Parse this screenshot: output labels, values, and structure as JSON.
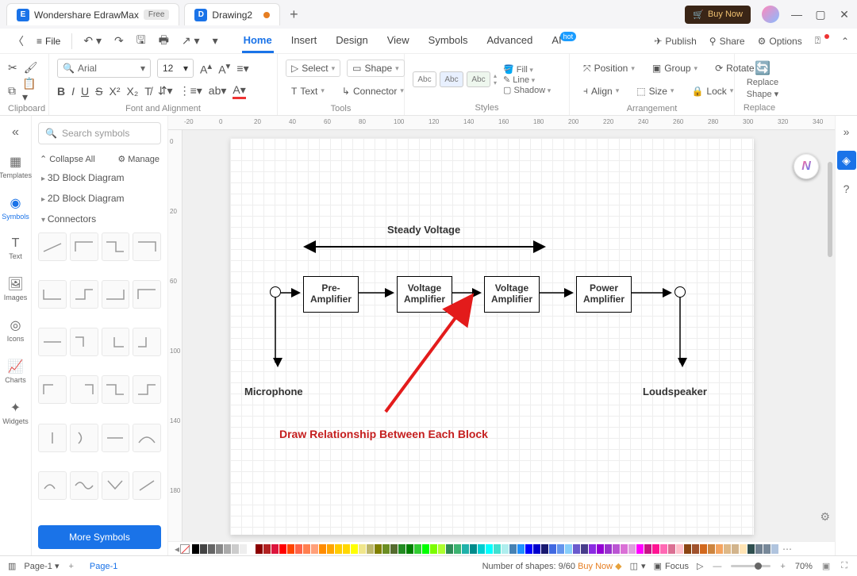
{
  "titlebar": {
    "app_name": "Wondershare EdrawMax",
    "free_badge": "Free",
    "doc_name": "Drawing2",
    "buy_now": "Buy Now"
  },
  "menubar": {
    "file": "File",
    "tabs": [
      "Home",
      "Insert",
      "Design",
      "View",
      "Symbols",
      "Advanced",
      "AI"
    ],
    "active": "Home",
    "hot": "hot",
    "publish": "Publish",
    "share": "Share",
    "options": "Options"
  },
  "ribbon": {
    "clipboard": "Clipboard",
    "font_alignment": "Font and Alignment",
    "tools_label": "Tools",
    "styles_label": "Styles",
    "arrangement": "Arrangement",
    "replace_label": "Replace",
    "font_name": "Arial",
    "font_size": "12",
    "select": "Select",
    "shape": "Shape",
    "text": "Text",
    "connector": "Connector",
    "abc": "Abc",
    "fill": "Fill",
    "line": "Line",
    "shadow": "Shadow",
    "position": "Position",
    "group": "Group",
    "rotate": "Rotate",
    "align": "Align",
    "size": "Size",
    "lock": "Lock",
    "replace_shape1": "Replace",
    "replace_shape2": "Shape"
  },
  "leftrail": {
    "templates": "Templates",
    "symbols": "Symbols",
    "text": "Text",
    "images": "Images",
    "icons": "Icons",
    "charts": "Charts",
    "widgets": "Widgets"
  },
  "symbol_panel": {
    "search_placeholder": "Search symbols",
    "collapse_all": "Collapse All",
    "manage": "Manage",
    "cat_3d": "3D Block Diagram",
    "cat_2d": "2D Block Diagram",
    "cat_conn": "Connectors",
    "more": "More Symbols"
  },
  "ruler": {
    "h": [
      "-20",
      "0",
      "20",
      "40",
      "60",
      "80",
      "100",
      "120",
      "140",
      "160",
      "180",
      "200",
      "220",
      "240",
      "260",
      "280",
      "300",
      "320",
      "340"
    ],
    "v": [
      "0",
      "20",
      "60",
      "100",
      "140",
      "180"
    ]
  },
  "diagram": {
    "steady_voltage": "Steady Voltage",
    "block1a": "Pre-",
    "block1b": "Amplifier",
    "block2a": "Voltage",
    "block2b": "Amplifier",
    "block3a": "Voltage",
    "block3b": "Amplifier",
    "block4a": "Power",
    "block4b": "Amplifier",
    "microphone": "Microphone",
    "loudspeaker": "Loudspeaker",
    "instruction": "Draw Relationship Between Each Block"
  },
  "statusbar": {
    "page_select": "Page-1",
    "page_tab": "Page-1",
    "shapes": "Number of shapes: 9/60",
    "buy_now": "Buy Now",
    "focus": "Focus",
    "zoom": "70%"
  },
  "colors": [
    "#000",
    "#444",
    "#666",
    "#888",
    "#aaa",
    "#ccc",
    "#eee",
    "#fff",
    "#8b0000",
    "#b22222",
    "#dc143c",
    "#ff0000",
    "#ff4500",
    "#ff6347",
    "#ff7f50",
    "#ffa07a",
    "#ff8c00",
    "#ffa500",
    "#ffcc00",
    "#ffd700",
    "#ffff00",
    "#f0e68c",
    "#bdb76b",
    "#808000",
    "#6b8e23",
    "#556b2f",
    "#228b22",
    "#008000",
    "#32cd32",
    "#00ff00",
    "#7cfc00",
    "#adff2f",
    "#2e8b57",
    "#3cb371",
    "#20b2aa",
    "#008b8b",
    "#00ced1",
    "#00ffff",
    "#40e0d0",
    "#afeeee",
    "#4682b4",
    "#1e90ff",
    "#0000ff",
    "#0000cd",
    "#191970",
    "#4169e1",
    "#6495ed",
    "#87cefa",
    "#6a5acd",
    "#483d8b",
    "#8a2be2",
    "#9400d3",
    "#9932cc",
    "#ba55d3",
    "#da70d6",
    "#dda0dd",
    "#ff00ff",
    "#c71585",
    "#ff1493",
    "#ff69b4",
    "#db7093",
    "#ffc0cb",
    "#8b4513",
    "#a0522d",
    "#d2691e",
    "#cd853f",
    "#f4a460",
    "#deb887",
    "#d2b48c",
    "#ffe4b5",
    "#2f4f4f",
    "#708090",
    "#778899",
    "#b0c4de"
  ]
}
